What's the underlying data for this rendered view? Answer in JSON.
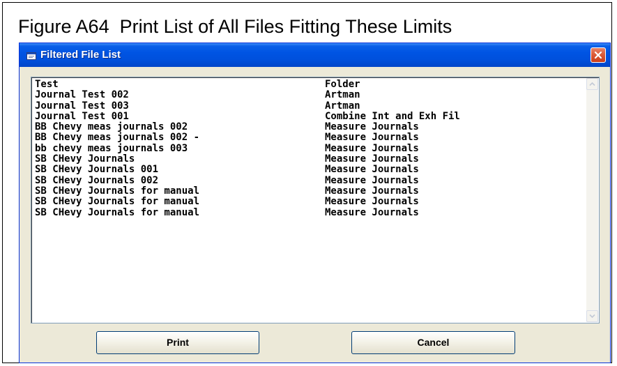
{
  "figure": {
    "caption": "Figure A64  Print List of All Files Fitting These Limits"
  },
  "window": {
    "title": "Filtered File List",
    "icon": "window-app-icon",
    "close_icon": "close-icon"
  },
  "file_list": {
    "rows": [
      {
        "name": "Test",
        "folder": "Folder"
      },
      {
        "name": "Journal Test 002",
        "folder": "Artman"
      },
      {
        "name": "Journal Test 003",
        "folder": "Artman"
      },
      {
        "name": "Journal Test 001",
        "folder": "Combine Int and Exh Fil"
      },
      {
        "name": "BB Chevy meas journals 002",
        "folder": "Measure Journals"
      },
      {
        "name": "BB Chevy meas journals 002 -",
        "folder": "Measure Journals"
      },
      {
        "name": "bb chevy meas journals 003",
        "folder": "Measure Journals"
      },
      {
        "name": "SB CHevy Journals",
        "folder": "Measure Journals"
      },
      {
        "name": "SB CHevy Journals 001",
        "folder": "Measure Journals"
      },
      {
        "name": "SB CHevy Journals 002",
        "folder": "Measure Journals"
      },
      {
        "name": "SB CHevy Journals for manual",
        "folder": "Measure Journals"
      },
      {
        "name": "SB CHevy Journals for manual",
        "folder": "Measure Journals"
      },
      {
        "name": "SB CHevy Journals for manual",
        "folder": "Measure Journals"
      }
    ]
  },
  "buttons": {
    "print_label": "Print",
    "cancel_label": "Cancel"
  },
  "colors": {
    "titlebar": "#0054e3",
    "dialog_face": "#ece9d8",
    "close_button": "#dc5c3a"
  }
}
